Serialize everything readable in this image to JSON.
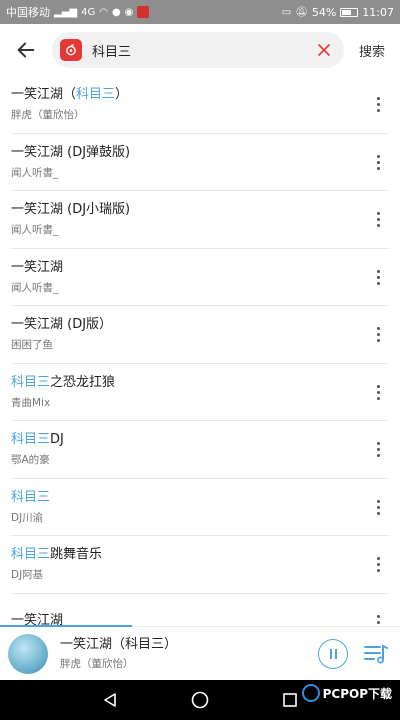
{
  "status_bar": {
    "carrier": "中国移动",
    "signal": "4G",
    "battery": "54%",
    "time": "11:07"
  },
  "search": {
    "query": "科目三",
    "submit_label": "搜索"
  },
  "results": [
    {
      "title": "一笑江湖（",
      "title_highlight": "科目三",
      "title_suffix": "）",
      "artist": "胖虎（董欣怡）"
    },
    {
      "title": "一笑江湖 (DJ弹鼓版)",
      "title_highlight": "",
      "title_suffix": "",
      "artist": "闻人听書_"
    },
    {
      "title": "一笑江湖 (DJ小瑞版)",
      "title_highlight": "",
      "title_suffix": "",
      "artist": "闻人听書_"
    },
    {
      "title": "一笑江湖",
      "title_highlight": "",
      "title_suffix": "",
      "artist": "闻人听書_"
    },
    {
      "title": "一笑江湖 (DJ版）",
      "title_highlight": "",
      "title_suffix": "",
      "artist": "困困了鱼"
    },
    {
      "title": "",
      "title_highlight": "科目三",
      "title_suffix": "之恐龙扛狼",
      "artist": "青曲Mix"
    },
    {
      "title": "",
      "title_highlight": "科目三",
      "title_suffix": "DJ",
      "artist": "鄂A的豪"
    },
    {
      "title": "",
      "title_highlight": "科目三",
      "title_suffix": "",
      "artist": "DJ川渝"
    },
    {
      "title": "",
      "title_highlight": "科目三",
      "title_suffix": "跳舞音乐",
      "artist": "DJ阿基"
    },
    {
      "title": "一笑江湖",
      "title_highlight": "",
      "title_suffix": "",
      "artist": ""
    }
  ],
  "now_playing": {
    "title": "一笑江湖（科目三）",
    "artist": "胖虎（董欣怡）",
    "progress": 0.33
  },
  "watermark": {
    "text": "PCPOP下载"
  },
  "colors": {
    "accent": "#4aa3df",
    "brand_red": "#e53935",
    "status_bar": "#8e8e8e"
  },
  "icons": {
    "back": "arrow-left-icon",
    "logo": "netease-music-icon",
    "clear": "close-icon",
    "more": "more-vertical-icon",
    "pause": "pause-icon",
    "playlist": "playlist-icon",
    "nav_back": "triangle-back-icon",
    "nav_home": "circle-home-icon",
    "nav_recent": "square-recent-icon"
  }
}
